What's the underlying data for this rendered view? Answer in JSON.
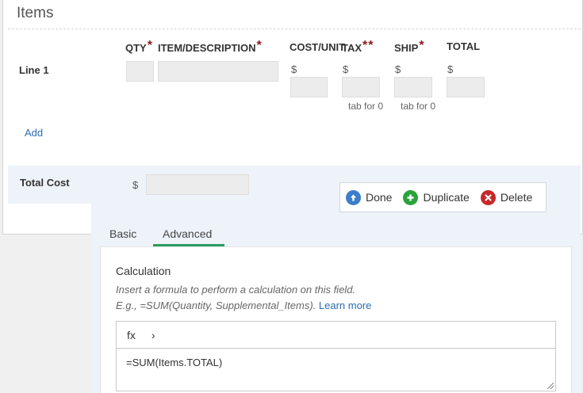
{
  "section": {
    "title": "Items"
  },
  "columns": {
    "qty": "QTY",
    "item": "ITEM/DESCRIPTION",
    "cost": "COST/UNIT",
    "tax": "TAX",
    "ship": "SHIP",
    "total": "TOTAL",
    "required_mark": "*"
  },
  "line": {
    "label": "Line 1",
    "currency": "$",
    "tax_hint": "tab for 0",
    "ship_hint": "tab for 0"
  },
  "add_label": "Add",
  "total_cost": {
    "label": "Total Cost",
    "currency": "$"
  },
  "toolbar": {
    "done": "Done",
    "duplicate": "Duplicate",
    "delete": "Delete"
  },
  "tabs": [
    {
      "label": "Basic",
      "active": false
    },
    {
      "label": "Advanced",
      "active": true
    }
  ],
  "calculation": {
    "title": "Calculation",
    "help_line1": "Insert a formula to perform a calculation on this field.",
    "help_line2": "E.g., =SUM(Quantity, Supplemental_Items).",
    "learn_more": "Learn more",
    "fx_label": "fx",
    "chevron": "›",
    "formula": "=SUM(Items.TOTAL)"
  },
  "colors": {
    "accent_tab": "#2e9c5e",
    "link": "#2a6db5",
    "required": "#8b1a1a",
    "done_icon": "#3d7ec9",
    "duplicate_icon": "#2aa33a",
    "delete_icon": "#c62828"
  },
  "icons": {
    "done": "arrow-up-circle-icon",
    "duplicate": "plus-circle-icon",
    "delete": "x-circle-icon"
  }
}
